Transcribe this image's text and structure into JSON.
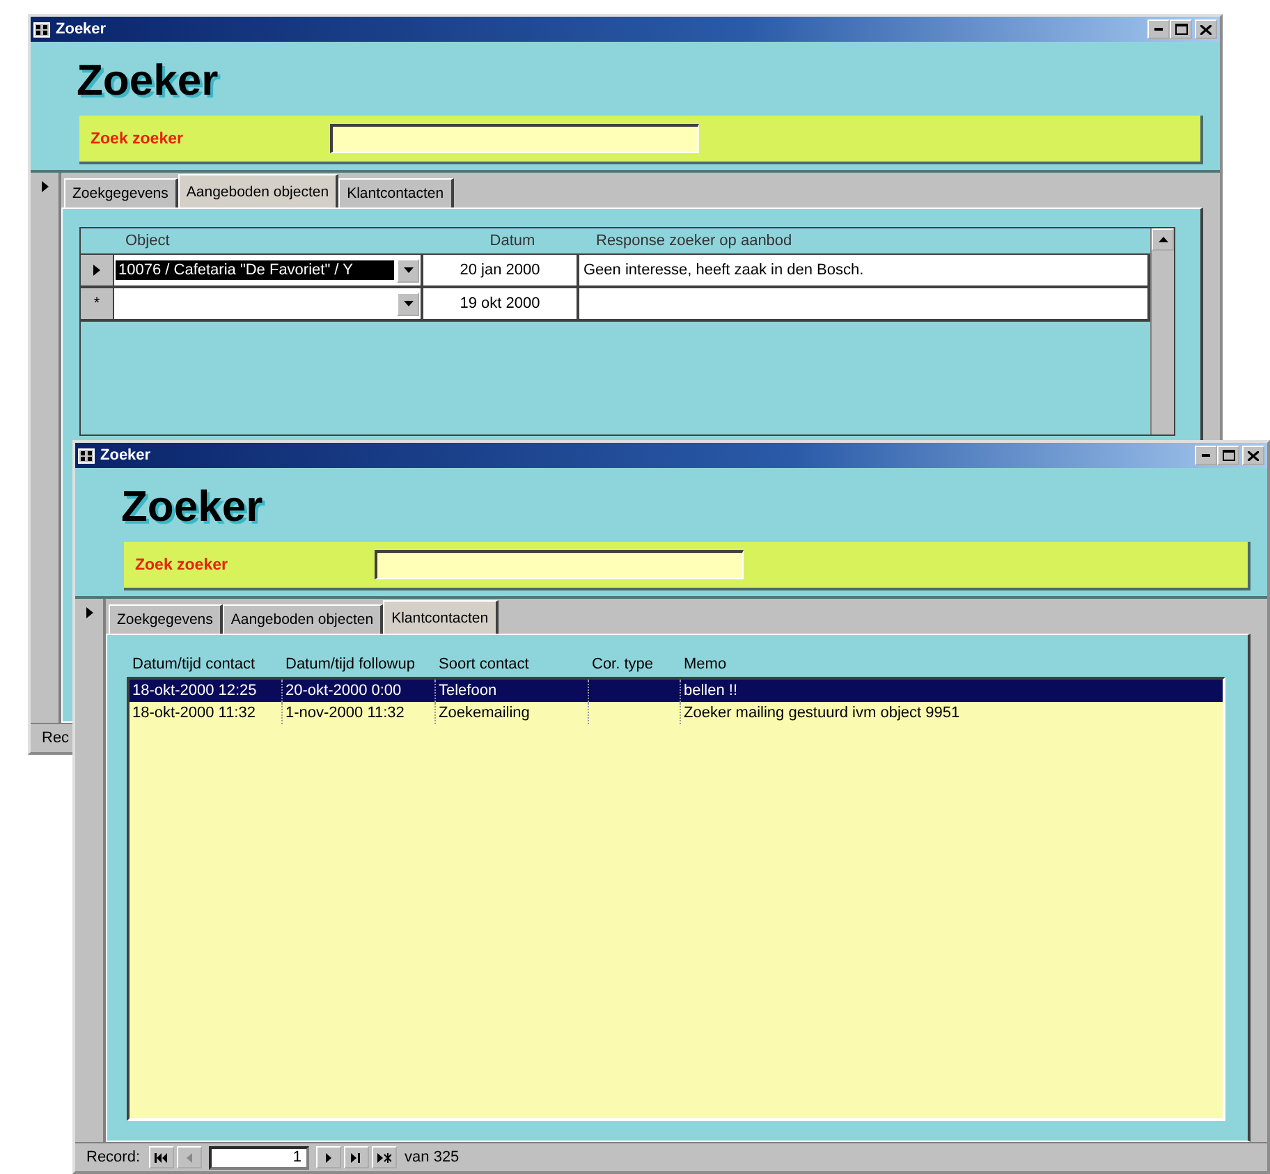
{
  "windows": [
    {
      "title": "Zoeker",
      "heading": "Zoeker",
      "search": {
        "label": "Zoek zoeker"
      },
      "tabs": [
        {
          "label": "Zoekgegevens",
          "selected": false
        },
        {
          "label": "Aangeboden objecten",
          "selected": true
        },
        {
          "label": "Klantcontacten",
          "selected": false
        }
      ],
      "subform": {
        "columns": [
          "Object",
          "Datum",
          "Response zoeker op aanbod"
        ],
        "rows": [
          {
            "selected": true,
            "object": "10076 / Cafetaria \"De Favoriet\" / Y",
            "datum": "20 jan 2000",
            "response": "Geen interesse, heeft zaak in den Bosch."
          },
          {
            "selected": false,
            "marker": "*",
            "datum": "19 okt 2000"
          }
        ]
      },
      "status_bar": {
        "label": "Rec"
      }
    },
    {
      "title": "Zoeker",
      "heading": "Zoeker",
      "search": {
        "label": "Zoek zoeker"
      },
      "tabs": [
        {
          "label": "Zoekgegevens",
          "selected": false
        },
        {
          "label": "Aangeboden objecten",
          "selected": false
        },
        {
          "label": "Klantcontacten",
          "selected": true
        }
      ],
      "list": {
        "columns": [
          "Datum/tijd contact",
          "Datum/tijd followup",
          "Soort contact",
          "Cor. type",
          "Memo"
        ],
        "rows": [
          {
            "selected": true,
            "cells": [
              "18-okt-2000 12:25",
              "20-okt-2000 0:00",
              "Telefoon",
              "",
              "bellen !!"
            ]
          },
          {
            "selected": false,
            "cells": [
              "18-okt-2000 11:32",
              "1-nov-2000 11:32",
              "Zoekemailing",
              "",
              "Zoeker mailing gestuurd ivm object 9951"
            ]
          }
        ]
      },
      "status_bar": {
        "label": "Record:",
        "current": "1",
        "total": "van 325"
      }
    }
  ]
}
